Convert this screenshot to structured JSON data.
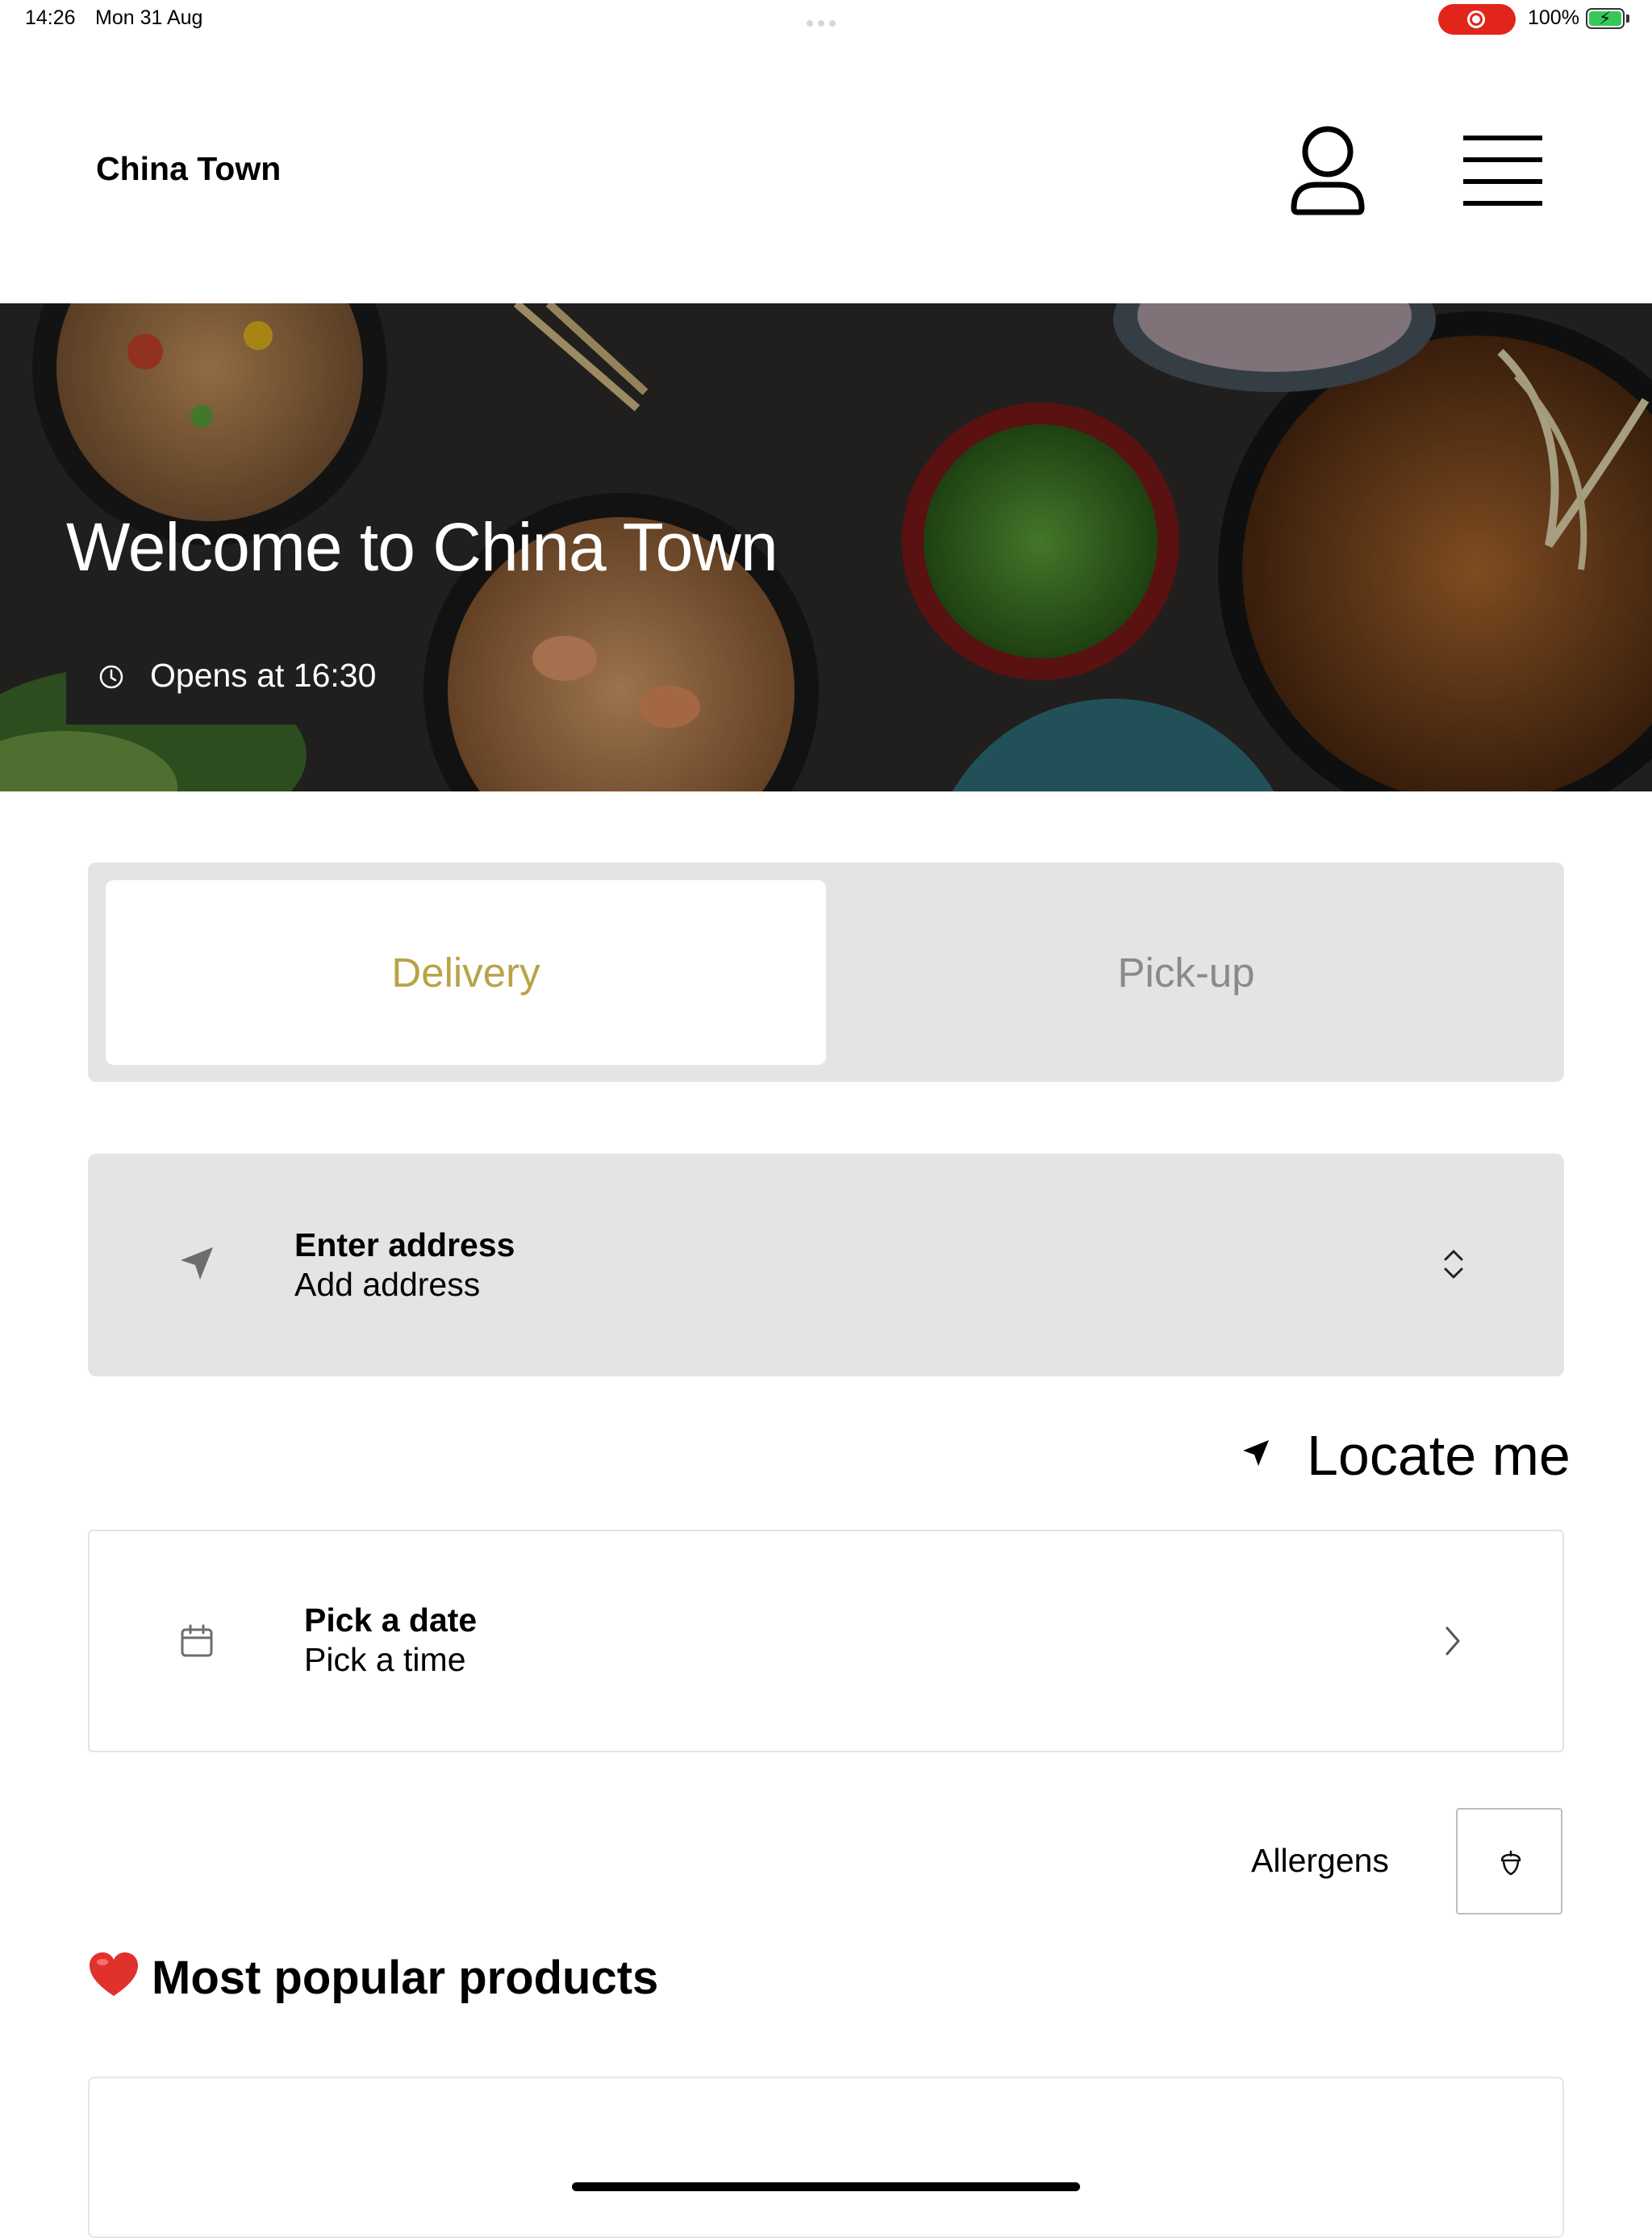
{
  "status_bar": {
    "time": "14:26",
    "date": "Mon 31 Aug",
    "battery": "100%"
  },
  "header": {
    "title": "China Town",
    "profile_icon": "person-icon",
    "menu_icon": "hamburger-menu-icon"
  },
  "hero": {
    "title": "Welcome to China Town",
    "opening": "Opens at 16:30",
    "clock_icon": "clock-icon"
  },
  "order_mode": {
    "tabs": [
      "Delivery",
      "Pick-up"
    ],
    "selected": "Delivery",
    "selected_color": "#b9a346"
  },
  "address": {
    "title": "Enter address",
    "subtitle": "Add address",
    "icon": "location-arrow-icon"
  },
  "locate": {
    "label": "Locate me",
    "icon": "location-arrow-icon"
  },
  "schedule": {
    "title": "Pick a date",
    "subtitle": "Pick a time",
    "icon": "calendar-icon"
  },
  "allergens": {
    "label": "Allergens",
    "icon": "acorn-icon"
  },
  "popular": {
    "title": "Most popular products",
    "icon": "heart-icon"
  }
}
